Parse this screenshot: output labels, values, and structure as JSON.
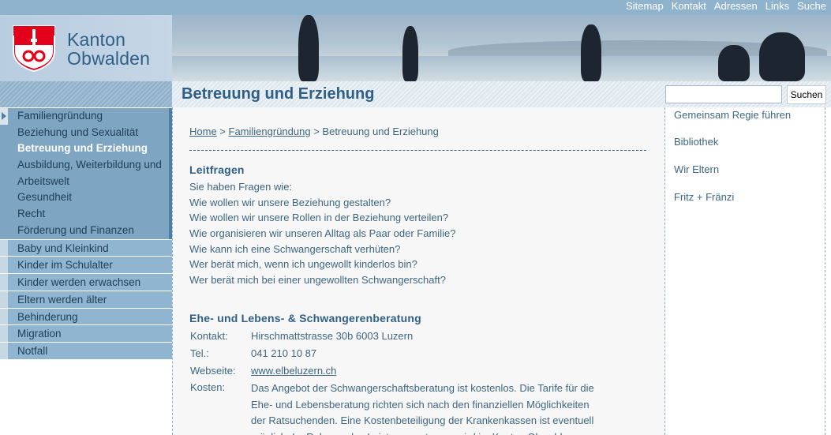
{
  "topnav": [
    "Sitemap",
    "Kontakt",
    "Adressen",
    "Links",
    "Suche"
  ],
  "brand": {
    "line1": "Kanton",
    "line2": "Obwalden"
  },
  "page_title": "Betreuung und Erziehung",
  "search": {
    "button_label": "Suchen",
    "value": ""
  },
  "leftnav": {
    "open_group": [
      {
        "label": "Familiengründung",
        "active": false
      },
      {
        "label": "Beziehung und Sexualität",
        "active": false
      },
      {
        "label": "Betreuung und Erziehung",
        "active": true
      },
      {
        "label": "Ausbildung, Weiterbildung und",
        "active": false
      },
      {
        "label": "Arbeitswelt",
        "active": false
      },
      {
        "label": "Gesundheit",
        "active": false
      },
      {
        "label": "Recht",
        "active": false
      },
      {
        "label": "Förderung und Finanzen",
        "active": false
      }
    ],
    "main_items": [
      "Baby und Kleinkind",
      "Kinder im Schulalter",
      "Kinder werden erwachsen",
      "Eltern werden älter",
      "Behinderung",
      "Migration",
      "Notfall"
    ]
  },
  "breadcrumb": {
    "home": "Home",
    "sep1": " > ",
    "level1": "Familiengründung",
    "sep2": " > ",
    "current": "Betreuung und Erziehung"
  },
  "leitfragen": {
    "heading": "Leitfragen",
    "intro": "Sie haben Fragen wie:",
    "questions": [
      "Wie wollen wir unsere Beziehung gestalten?",
      "Wie wollen wir unsere Rollen in der Beziehung verteilen?",
      "Wie organisieren wir unseren Alltag als Paar oder Familie?",
      "Wie kann ich eine Schwangerschaft verhüten?",
      "Wer berät mich, wenn ich ungewollt kinderlos bin?",
      "Wer berät mich bei einer ungewollten Schwangerschaft?"
    ]
  },
  "beratung": {
    "heading": "Ehe- und Lebens- & Schwangerenberatung",
    "kontakt_label": "Kontakt:",
    "kontakt_value": "Hirschmattstrasse 30b 6003 Luzern",
    "tel_label": "Tel.:",
    "tel_value": "041 210 10 87",
    "web_label": "Webseite:",
    "web_value": "www.elbeluzern.ch",
    "kosten_label": "Kosten:",
    "kosten_value": "Das Angebot der Schwangerschaftsberatung ist kostenlos. Die Tarife für die Ehe- und Lebensberatung richten sich nach den finanziellen Möglichkeiten der Ratsuchenden. Eine Kostenbeteiligung der Krankenkassen ist eventuell möglich. Im Rahmen des Leistungsvertrages wird im Kanton Obwalden"
  },
  "right_links": [
    "Gemeinsam Regie führen",
    "Bibliothek",
    "Wir Eltern",
    "Fritz + Fränzi"
  ],
  "colors": {
    "accent": "#2f5f86",
    "nav_bg": "#7ea5c2",
    "topbar": "#8fb3cc"
  }
}
